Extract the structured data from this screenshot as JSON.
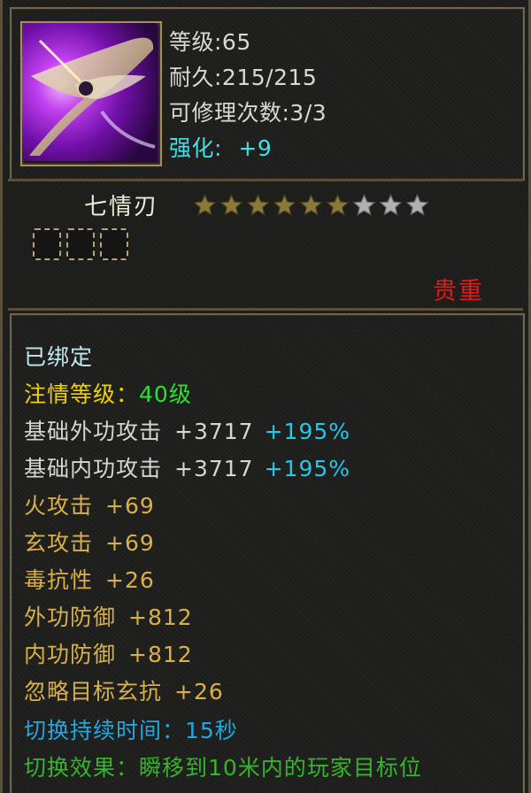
{
  "header": {
    "icon": "weapon-blade-icon",
    "level": "等级:65",
    "durability": "耐久:215/215",
    "repairs": "可修理次数:3/3",
    "enhance_label": "强化:",
    "enhance_value": "+9"
  },
  "item": {
    "name": "七情刃",
    "stars_filled": 6,
    "stars_total": 9,
    "sockets": 3,
    "rarity": "贵重"
  },
  "attributes": {
    "bound": "已绑定",
    "emotion_label": "注情等级：",
    "emotion_value": "40级",
    "base_ext_label": "基础外功攻击",
    "base_ext_value": "+3717",
    "base_ext_pct": "+195%",
    "base_int_label": "基础内功攻击",
    "base_int_value": "+3717",
    "base_int_pct": "+195%",
    "fire_label": "火攻击",
    "fire_value": "+69",
    "mystic_label": "玄攻击",
    "mystic_value": "+69",
    "poison_res_label": "毒抗性",
    "poison_res_value": "+26",
    "ext_def_label": "外功防御",
    "ext_def_value": "+812",
    "int_def_label": "内功防御",
    "int_def_value": "+812",
    "ignore_label": "忽略目标玄抗",
    "ignore_value": "+26",
    "switch_duration": "切换持续时间：15秒",
    "switch_effect": "切换效果：瞬移到10米内的玩家目标位"
  },
  "colors": {
    "enhance": "#3fe0e6",
    "rarity": "#e41a1a",
    "emotion_value": "#2ee02e",
    "percent": "#25c8ea",
    "stat": "#f0d200",
    "star_filled": "#8a7a3a",
    "star_empty": "#b0b0b0"
  }
}
